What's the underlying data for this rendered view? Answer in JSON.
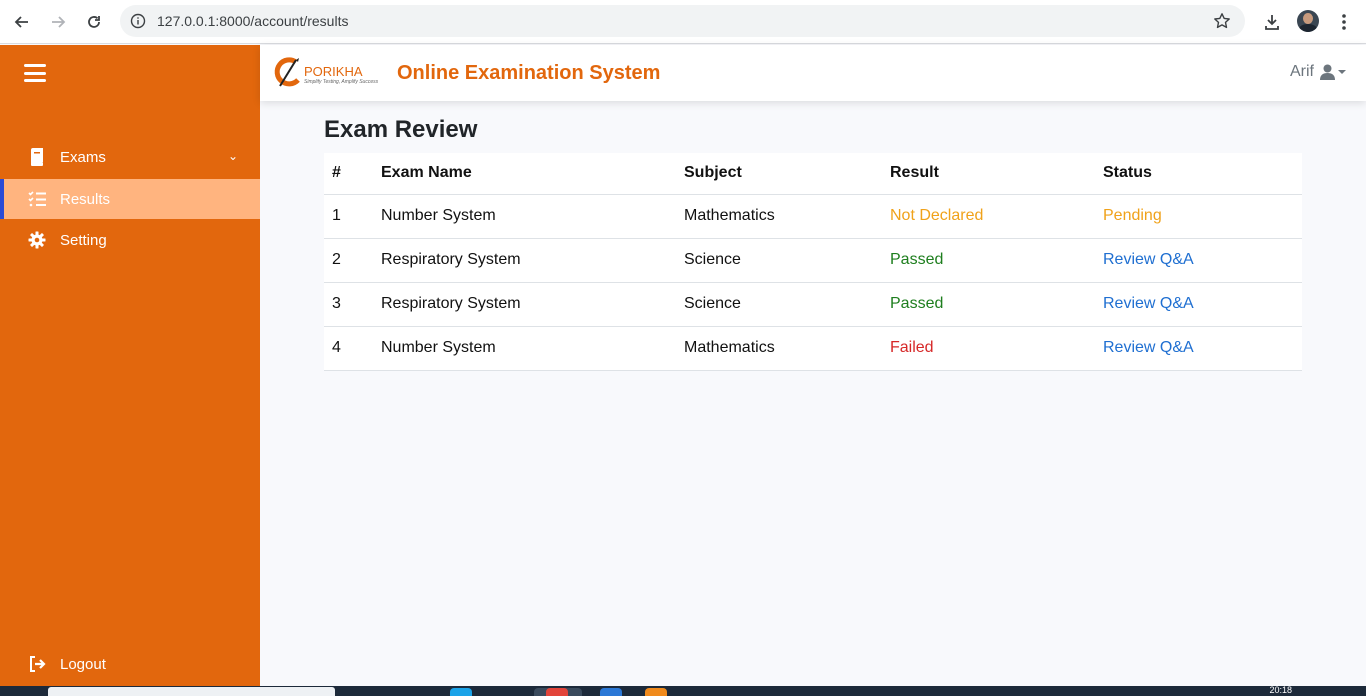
{
  "browser": {
    "url": "127.0.0.1:8000/account/results"
  },
  "sidebar": {
    "items": [
      {
        "label": "Exams",
        "icon": "book-icon"
      },
      {
        "label": "Results",
        "icon": "list-check-icon",
        "active": true
      },
      {
        "label": "Setting",
        "icon": "gear-icon"
      }
    ],
    "logout_label": "Logout"
  },
  "header": {
    "logo_text": "PORIKHA",
    "logo_tagline": "Simplify Testing, Amplify Success",
    "title": "Online Examination System",
    "user_name": "Arif"
  },
  "main": {
    "title": "Exam Review",
    "table": {
      "headers": [
        "#",
        "Exam Name",
        "Subject",
        "Result",
        "Status"
      ],
      "rows": [
        {
          "num": "1",
          "exam": "Number System",
          "subject": "Mathematics",
          "result": "Not Declared",
          "status": "Pending"
        },
        {
          "num": "2",
          "exam": "Respiratory System",
          "subject": "Science",
          "result": "Passed",
          "status": "Review Q&A"
        },
        {
          "num": "3",
          "exam": "Respiratory System",
          "subject": "Science",
          "result": "Passed",
          "status": "Review Q&A"
        },
        {
          "num": "4",
          "exam": "Number System",
          "subject": "Mathematics",
          "result": "Failed",
          "status": "Review Q&A"
        }
      ]
    }
  },
  "taskbar": {
    "clock": "20:18"
  },
  "colors": {
    "brand": "#e2670d",
    "active_item": "#ffb47f",
    "warning": "#f0a21a",
    "success": "#1e7e1e",
    "danger": "#d62828",
    "link": "#1f6fd1"
  }
}
